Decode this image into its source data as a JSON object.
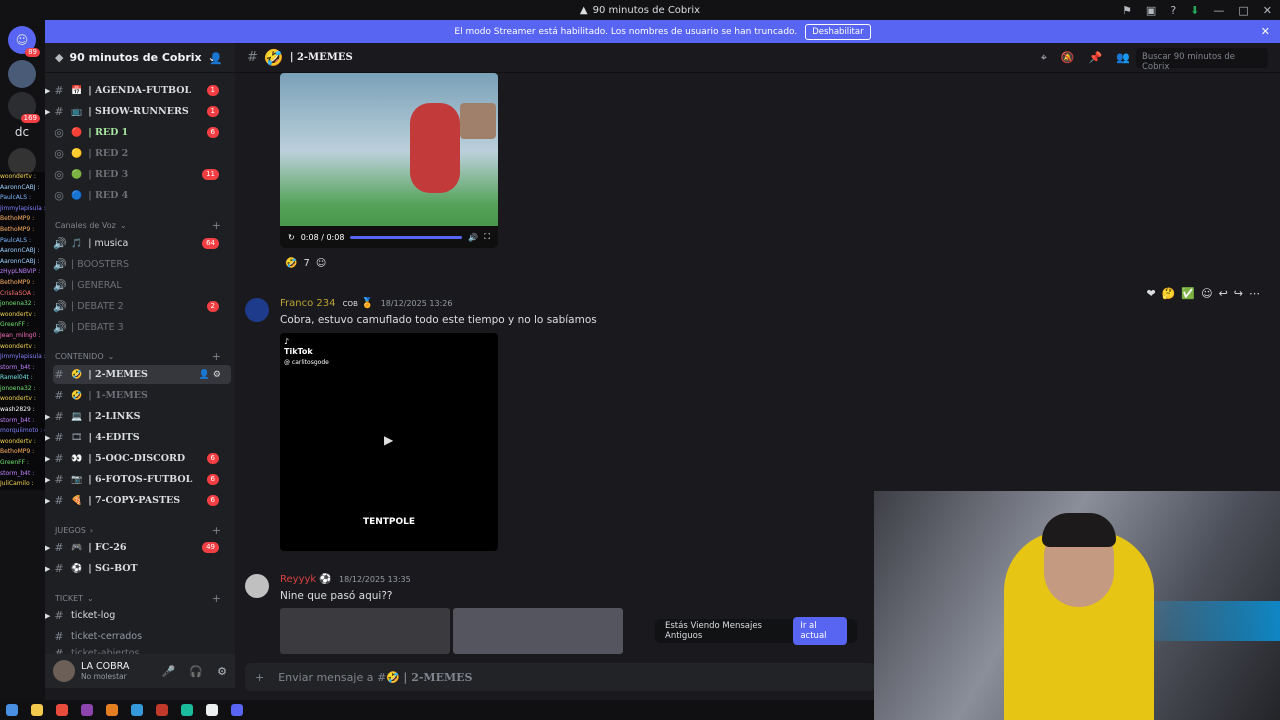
{
  "window": {
    "title": "90 minutos de Cobrix"
  },
  "streamer_banner": {
    "text": "El modo Streamer está habilitado. Los nombres de usuario se han truncado.",
    "button": "Deshabilitar"
  },
  "servers": [
    {
      "label": "",
      "badge": "89"
    },
    {
      "label": "",
      "badge": ""
    },
    {
      "label": "",
      "badge": "169"
    },
    {
      "label": "dc",
      "badge": ""
    },
    {
      "label": "",
      "badge": ""
    }
  ],
  "overlay_chat": [
    "woondertv :",
    "AaronnCABJ :",
    "PaulcALS :",
    "Jimmylapisula : B DE BERNABEU",
    "BethoMP9 :",
    "BethoMP9 :",
    "PaulcALS :",
    "AaronnCABJ :",
    "AaronnCABJ :",
    "zHypLNBVIP :",
    "BethoMP9 :",
    "CrisliaSOA :",
    "jonoena32 :",
    "woondertv :",
    "GreenFF :",
    "Jean_milng0 :",
    "woondertv :",
    "Jimmylapisula : B DE BERNABEU",
    "storm_b4t :",
    "Ramel04t :",
    "jonoena32 :",
    "woondertv :",
    "wash2829 :",
    "storm_b4t :",
    "morquiimoto : cobra por cuanto entregas el culo",
    "woondertv :",
    "BethoMP9 :",
    "GreenFF :",
    "storm_b4t :",
    "JuliCamilo :"
  ],
  "guild": {
    "name": "90 minutos de Cobrix"
  },
  "channels": [
    {
      "name": "| AGENDA-FUTBOL",
      "emoji": "📅",
      "badge": "1",
      "style": "serif"
    },
    {
      "name": "| SHOW-RUNNERS",
      "emoji": "📺",
      "badge": "1",
      "style": "serif"
    },
    {
      "name": "| RED 1",
      "emoji": "🔴",
      "badge": "6",
      "style": "green"
    },
    {
      "name": "| RED 2",
      "emoji": "🟡",
      "badge": "",
      "style": "muted"
    },
    {
      "name": "| RED 3",
      "emoji": "🟢",
      "badge": "11",
      "style": "muted"
    },
    {
      "name": "| RED 4",
      "emoji": "🔵",
      "badge": "",
      "style": "muted"
    }
  ],
  "categories": {
    "voice": "Canales de Voz",
    "content": "CONTENIDO",
    "games": "JUEGOS",
    "ticket": "TICKET"
  },
  "voice_channels": [
    {
      "name": "| musica",
      "badge": "64"
    },
    {
      "name": "| BOOSTERS",
      "badge": ""
    },
    {
      "name": "| GENERAL",
      "badge": ""
    },
    {
      "name": "| DEBATE 2",
      "badge": "2"
    },
    {
      "name": "| DEBATE 3",
      "badge": ""
    }
  ],
  "content_channels": [
    {
      "name": "| 2-MEMES",
      "badge": "",
      "active": true
    },
    {
      "name": "| 1-MEMES",
      "badge": "",
      "muted": true
    },
    {
      "name": "| 2-LINKS",
      "badge": ""
    },
    {
      "name": "| 4-EDITS",
      "badge": ""
    },
    {
      "name": "| 5-OOC-DISCORD",
      "badge": "6"
    },
    {
      "name": "| 6-FOTOS-FUTBOL",
      "badge": "6"
    },
    {
      "name": "| 7-COPY-PASTES",
      "badge": "6"
    }
  ],
  "game_channels": [
    {
      "name": "| FC-26",
      "badge": "49"
    },
    {
      "name": "| SG-BOT",
      "badge": ""
    }
  ],
  "ticket_channels": [
    {
      "name": "ticket-log"
    },
    {
      "name": "ticket-cerrados"
    },
    {
      "name": "ticket-abiertos"
    }
  ],
  "user": {
    "name": "LA COBRA",
    "status": "No molestar"
  },
  "channel_header": {
    "name": "| 2-MEMES",
    "search_placeholder": "Buscar 90 minutos de Cobrix"
  },
  "video": {
    "time": "0:08 / 0:08",
    "progress": 1.0
  },
  "reactions": {
    "count": "7"
  },
  "messages": [
    {
      "author": "Franco 234",
      "tag": "COB",
      "time": "18/12/2025 13:26",
      "text": "Cobra, estuvo camuflado todo este tiempo y no lo sabíamos",
      "author_color": "#b8a233"
    },
    {
      "author": "Reyyyk",
      "tag": "",
      "time": "18/12/2025 13:35",
      "text": "Nine que pasó aqui??",
      "author_color": "#d84040"
    }
  ],
  "tiktok": {
    "brand": "TikTok",
    "handle": "@ carlitosgode",
    "caption": "TENTPOLE"
  },
  "older_messages": {
    "text": "Estás Viendo Mensajes Antiguos",
    "jump": "Ir al actual"
  },
  "composer": {
    "prefix": "Enviar mensaje a #",
    "channel": "| 2-MEMES"
  }
}
